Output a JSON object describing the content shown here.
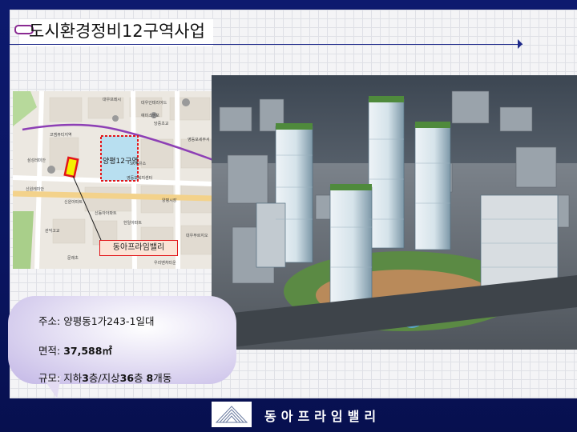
{
  "title": "도시환경정비12구역사업",
  "map": {
    "zone_label": "양평12구역",
    "callout": "동아프라임밸리",
    "labels": {
      "top_a": "대우프레시",
      "top_b": "대우인테리어드",
      "top_c": "예미스앤포",
      "top_d": "당중초교",
      "left_a": "코엠뷰티지역",
      "left_b": "삼성레미안",
      "left_c": "신원레미안",
      "left_d": "신원아파트",
      "left_e": "관악고교",
      "left_f": "문래초",
      "mid_a": "영등포복지센터",
      "mid_b": "SK주유소",
      "mid_c": "양평시장",
      "mid_d": "신동아아파트",
      "mid_e": "한일아파트",
      "right_a": "영등포세무서",
      "right_b": "대우푸르지오",
      "right_c": "우리벤처타운"
    }
  },
  "info": {
    "address_label": "주소: ",
    "address_value": "양평동1가243-1일대",
    "area_label": "면적: ",
    "area_value": "37,588㎡",
    "scale_label": "규모: ",
    "scale_text_1": "지하",
    "scale_num_1": "3",
    "scale_text_2": "층/지상",
    "scale_num_2": "36",
    "scale_text_3": "층 ",
    "scale_num_3": "8",
    "scale_text_4": "개동"
  },
  "footer": {
    "company": "동아프라임밸리"
  },
  "colors": {
    "background": "#0a1560",
    "accent": "#8a2a92",
    "marker": "#e2161a"
  }
}
